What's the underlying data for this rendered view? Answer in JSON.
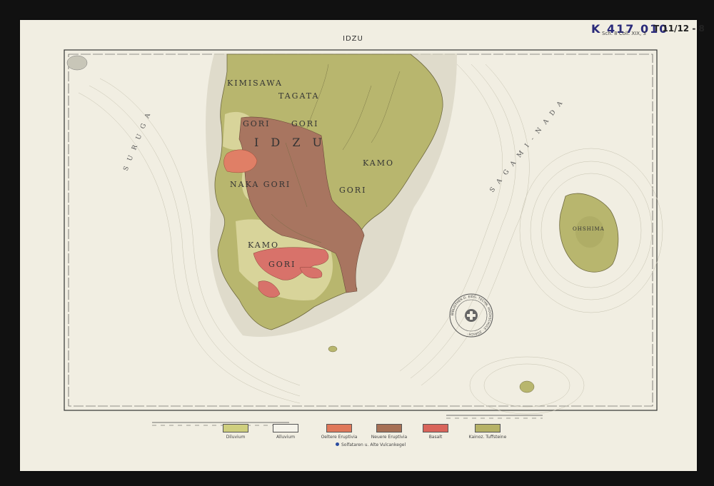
{
  "sheet": {
    "title": "IDZU",
    "catalog_number": "K 417 010",
    "catalog_subtitle": "Sch. 8 Coll. XIX, 3",
    "sheet_number": "T 11/12 - 8"
  },
  "regions": {
    "kimisawa": "KIMISAWA",
    "tagata": "TAGATA",
    "gori_1": "GORI",
    "gori_2": "GORI",
    "idzu": "I D Z U",
    "kamo_east": "KAMO",
    "gori_3": "GORI",
    "naka_gori": "NAKA GORI",
    "kamo_south": "KAMO",
    "gori_4": "GORI",
    "oshima": "OHSHIMA"
  },
  "seas": {
    "suruga": "S U R U G A",
    "sagami_nada": "S A G A M I - N A D A"
  },
  "stamp": {
    "text": "BIBLIOTHEK D. EIDG. TECHN. HOCHSCHULE · ZÜRICH ·"
  },
  "legend": {
    "items": [
      {
        "label": "Diluvium",
        "symbol": "d",
        "color": "#cfcf7e"
      },
      {
        "label": "Alluvium",
        "symbol": "",
        "color": "#f5f3ea"
      },
      {
        "label": "Oeltere Eruptivia",
        "symbol": "r",
        "color": "#e0785a"
      },
      {
        "label": "Neuere Eruptivia",
        "symbol": "b",
        "color": "#a77055"
      },
      {
        "label": "Basalt",
        "symbol": "a",
        "color": "#d9645a"
      },
      {
        "label": "Kainoz. Tuffsteine",
        "symbol": "tt",
        "color": "#b6b266"
      }
    ],
    "note": "Solfataren u. Alte Vulcankegel"
  },
  "colors": {
    "land_olive": "#b8b66e",
    "land_light": "#d8d49a",
    "brown_zone": "#a87560",
    "orange_zone": "#e07f66",
    "red_zone": "#d8726a",
    "coast_shade": "#c9c5b2"
  }
}
